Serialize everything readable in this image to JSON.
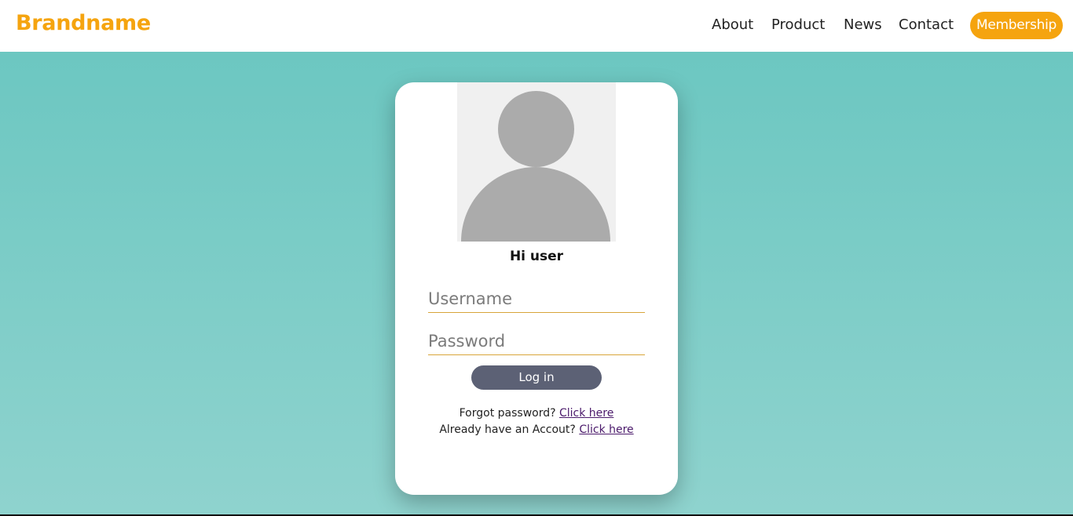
{
  "header": {
    "brand": "Brandname",
    "nav": [
      "About",
      "Product",
      "News",
      "Contact"
    ],
    "cta_label": "Membership"
  },
  "colors": {
    "brand": "#f5a40f",
    "background_top": "#6cc7c1",
    "background_bottom": "#8fd3ce",
    "login_button": "#5c6175"
  },
  "login_card": {
    "avatar_icon": "user-silhouette-icon",
    "greeting": "Hi user",
    "username_placeholder": "Username",
    "password_placeholder": "Password",
    "login_label": "Log in",
    "forgot_text": "Forgot password?",
    "forgot_link": "Click here",
    "account_text": "Already have an Accout?",
    "account_link": "Click here"
  }
}
